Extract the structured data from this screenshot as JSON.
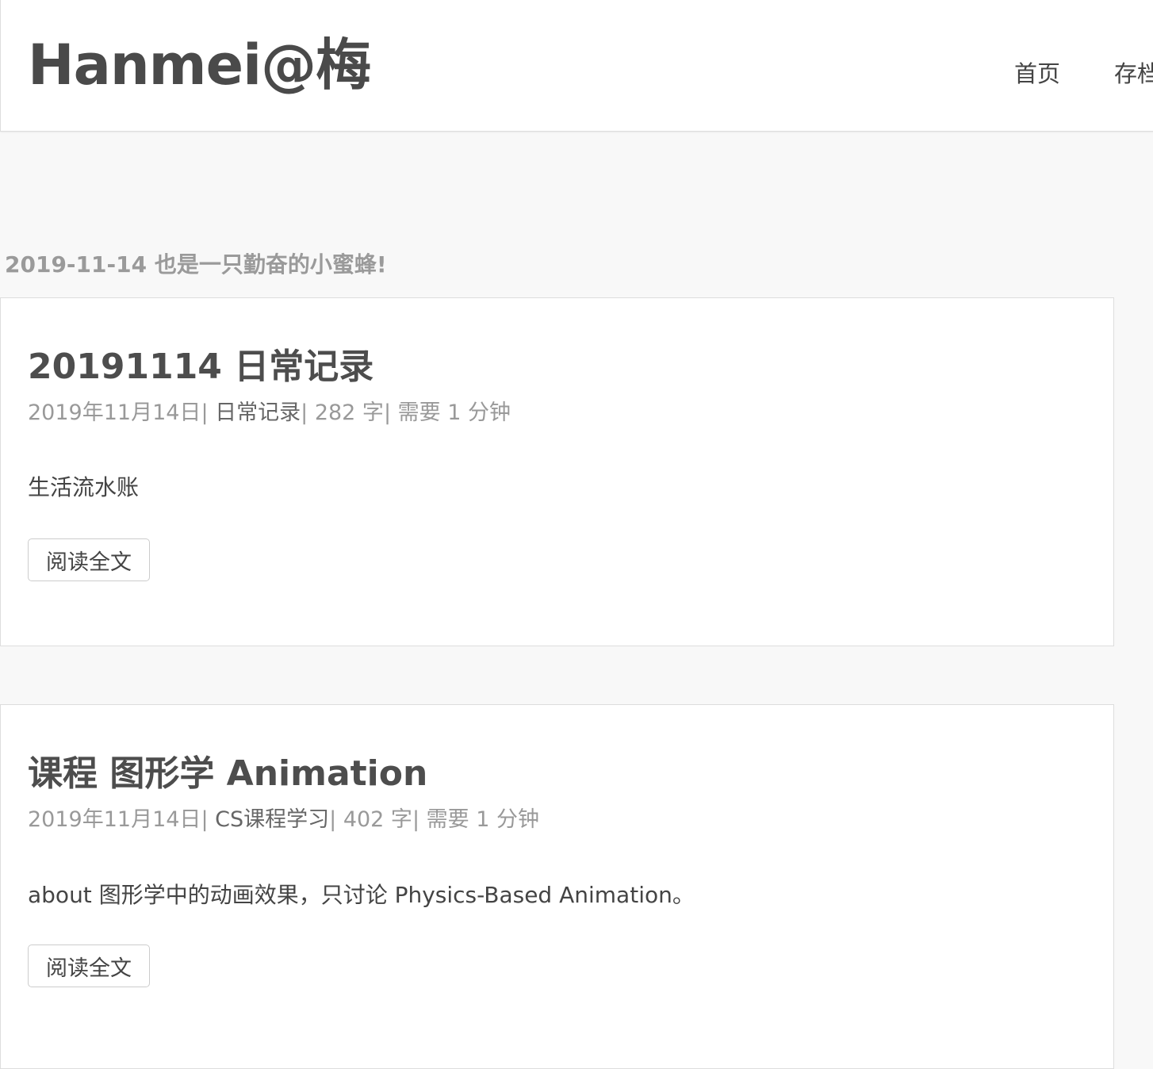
{
  "header": {
    "logo": "Hanmei@梅",
    "nav": [
      {
        "label": "首页"
      },
      {
        "label": "存档"
      }
    ]
  },
  "subtitle": "2019-11-14 也是一只勤奋的小蜜蜂!",
  "posts": [
    {
      "title": "20191114 日常记录",
      "date": "2019年11月14日",
      "category": "日常记录",
      "words": "282 字",
      "read_time": "需要 1 分钟",
      "excerpt": "生活流水账",
      "read_more": "阅读全文"
    },
    {
      "title": "课程 图形学 Animation",
      "date": "2019年11月14日",
      "category": "CS课程学习",
      "words": "402 字",
      "read_time": "需要 1 分钟",
      "excerpt": "about 图形学中的动画效果，只讨论 Physics-Based Animation。",
      "read_more": "阅读全文"
    }
  ]
}
